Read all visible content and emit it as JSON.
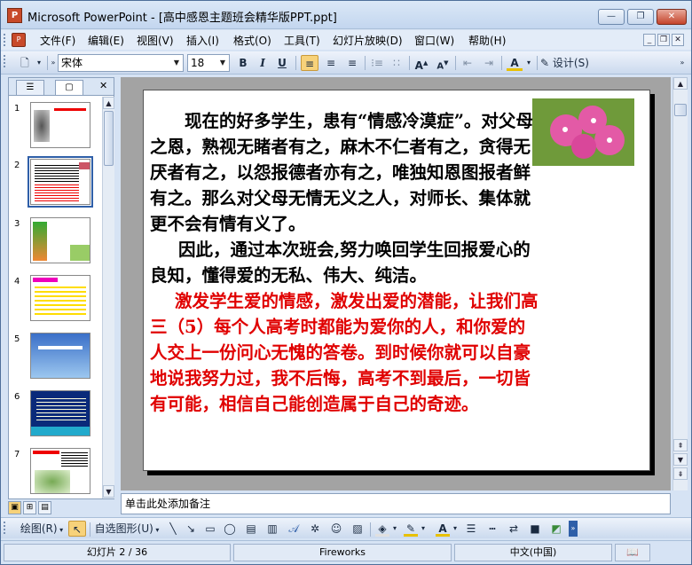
{
  "window": {
    "app_icon": "P",
    "title": "Microsoft PowerPoint - [高中感恩主题班会精华版PPT.ppt]",
    "minimize_label": "—",
    "restore_label": "❐",
    "close_label": "✕"
  },
  "menubar": {
    "items": [
      "文件(F)",
      "编辑(E)",
      "视图(V)",
      "插入(I)",
      "格式(O)",
      "工具(T)",
      "幻灯片放映(D)",
      "窗口(W)",
      "帮助(H)"
    ],
    "mdi_min": "_",
    "mdi_restore": "❐",
    "mdi_close": "✕"
  },
  "toolbar": {
    "font_name": "宋体",
    "font_size": "18",
    "bold": "B",
    "italic": "I",
    "underline": "U",
    "design_label": "设计(S)"
  },
  "left_panel": {
    "tab_outline": "☰",
    "tab_slides": "▢",
    "close": "✕",
    "thumbnails": [
      {
        "num": "1"
      },
      {
        "num": "2"
      },
      {
        "num": "3"
      },
      {
        "num": "4"
      },
      {
        "num": "5"
      },
      {
        "num": "6"
      },
      {
        "num": "7"
      }
    ]
  },
  "slide": {
    "para1": "现在的好多学生，患有“情感冷漠症”。对父母之恩，熟视无睹者有之，麻木不仁者有之，贪得无厌者有之，以怨报德者亦有之，唯独知恩图报者鲜有之。那么对父母无情无义之人，对师长、集体就更不会有情有义了。",
    "para2": "因此，通过本次班会,努力唤回学生回报爱心的良知，懂得爱的无私、伟大、纯洁。",
    "para3": "激发学生爱的情感，激发出爱的潜能，让我们高三（5）每个人高考时都能为爱你的人，和你爱的人交上一份问心无愧的答卷。到时候你就可以自豪地说我努力过，我不后悔，高考不到最后，一切皆有可能，相信自己能创造属于自己的奇迹。",
    "text_color": "#000000",
    "highlight_color": "#e00000"
  },
  "notes": {
    "placeholder": "单击此处添加备注"
  },
  "drawbar": {
    "draw_label": "绘图(R)",
    "autoshape_label": "自选图形(U)"
  },
  "status": {
    "slide_counter": "幻灯片 2 / 36",
    "design": "Fireworks",
    "language": "中文(中国)"
  },
  "colors": {
    "accent": "#2f5fa8",
    "active_button": "#f7d27a"
  }
}
